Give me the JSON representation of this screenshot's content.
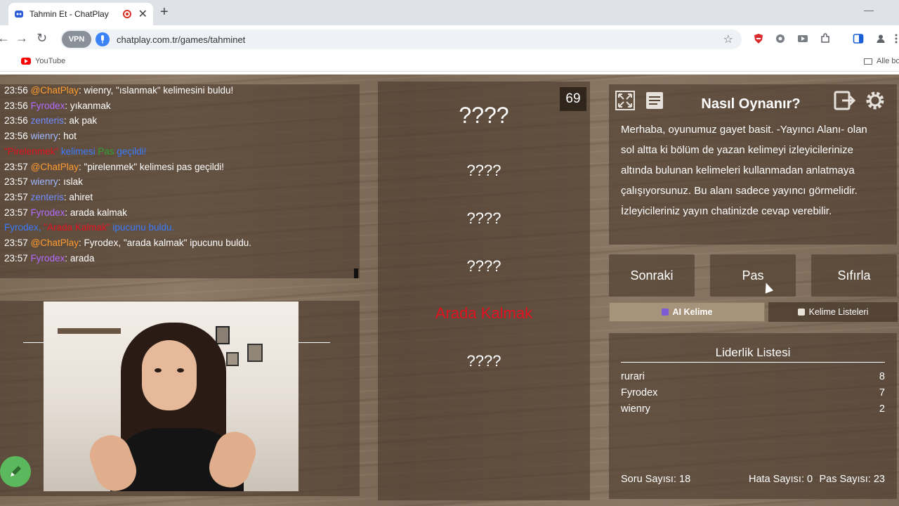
{
  "browser": {
    "tab_title": "Tahmin Et - ChatPlay",
    "url": "chatplay.com.tr/games/tahminet",
    "vpn_label": "VPN",
    "bookmarks": [
      {
        "label": "YouTube"
      },
      {
        "label": "Alle bo"
      }
    ]
  },
  "chat": {
    "messages": [
      {
        "time": "23:56",
        "user": "@ChatPlay",
        "user_color": "#ff9b2f",
        "text": ": wienry, \"ıslanmak\" kelimesini buldu!"
      },
      {
        "time": "23:56",
        "user": "Fyrodex",
        "user_color": "#b36bff",
        "text": ": yıkanmak"
      },
      {
        "time": "23:56",
        "user": "zenteris",
        "user_color": "#6f8cff",
        "text": ": ak pak"
      },
      {
        "time": "23:56",
        "user": "wienry",
        "user_color": "#9fb8ff",
        "text": ": hot"
      },
      {
        "time": "23:57",
        "user": "@ChatPlay",
        "user_color": "#ff9b2f",
        "text": ": \"pirelenmek\" kelimesi pas geçildi!"
      },
      {
        "time": "23:57",
        "user": "wienry",
        "user_color": "#9fb8ff",
        "text": ": ıslak"
      },
      {
        "time": "23:57",
        "user": "zenteris",
        "user_color": "#6f8cff",
        "text": ": ahiret"
      },
      {
        "time": "23:57",
        "user": "Fyrodex",
        "user_color": "#b36bff",
        "text": ": arada kalmak"
      },
      {
        "time": "23:57",
        "user": "@ChatPlay",
        "user_color": "#ff9b2f",
        "text": ": Fyrodex, \"arada kalmak\" ipucunu buldu."
      },
      {
        "time": "23:57",
        "user": "Fyrodex",
        "user_color": "#b36bff",
        "text": ": arada"
      }
    ],
    "system_pass": {
      "word": "\"Pirelenmek\"",
      "mid": " kelimesi ",
      "pas": "Pas",
      "end": " geçildi!"
    },
    "system_found": {
      "user": "Fyrodex, ",
      "word": "\"Arada Kalmak\"",
      "end": " ipucunu buldu."
    }
  },
  "game": {
    "timer": "69",
    "main_word": "????",
    "hints": [
      "????",
      "????",
      "????",
      "Arada Kalmak",
      "????"
    ]
  },
  "howto": {
    "title": "Nasıl Oynanır?",
    "text": "Merhaba, oyunumuz gayet basit. -Yayıncı Alanı- olan sol altta ki bölüm de yazan kelimeyi izleyicilerinize altında bulunan kelimeleri kullanmadan anlatmaya çalışıyorsunuz. Bu alanı sadece yayıncı görmelidir. İzleyicileriniz yayın chatinizde cevap verebilir."
  },
  "actions": {
    "next": "Sonraki",
    "pass": "Pas",
    "reset": "Sıfırla"
  },
  "modes": {
    "ai": "AI Kelime",
    "lists": "Kelime Listeleri"
  },
  "leaderboard": {
    "title": "Liderlik Listesi",
    "rows": [
      {
        "name": "rurari",
        "score": "8"
      },
      {
        "name": "Fyrodex",
        "score": "7"
      },
      {
        "name": "wienry",
        "score": "2"
      }
    ],
    "questions": "Soru Sayısı: 18",
    "errors": "Hata Sayısı: 0",
    "passes": "Pas Sayısı: 23"
  }
}
